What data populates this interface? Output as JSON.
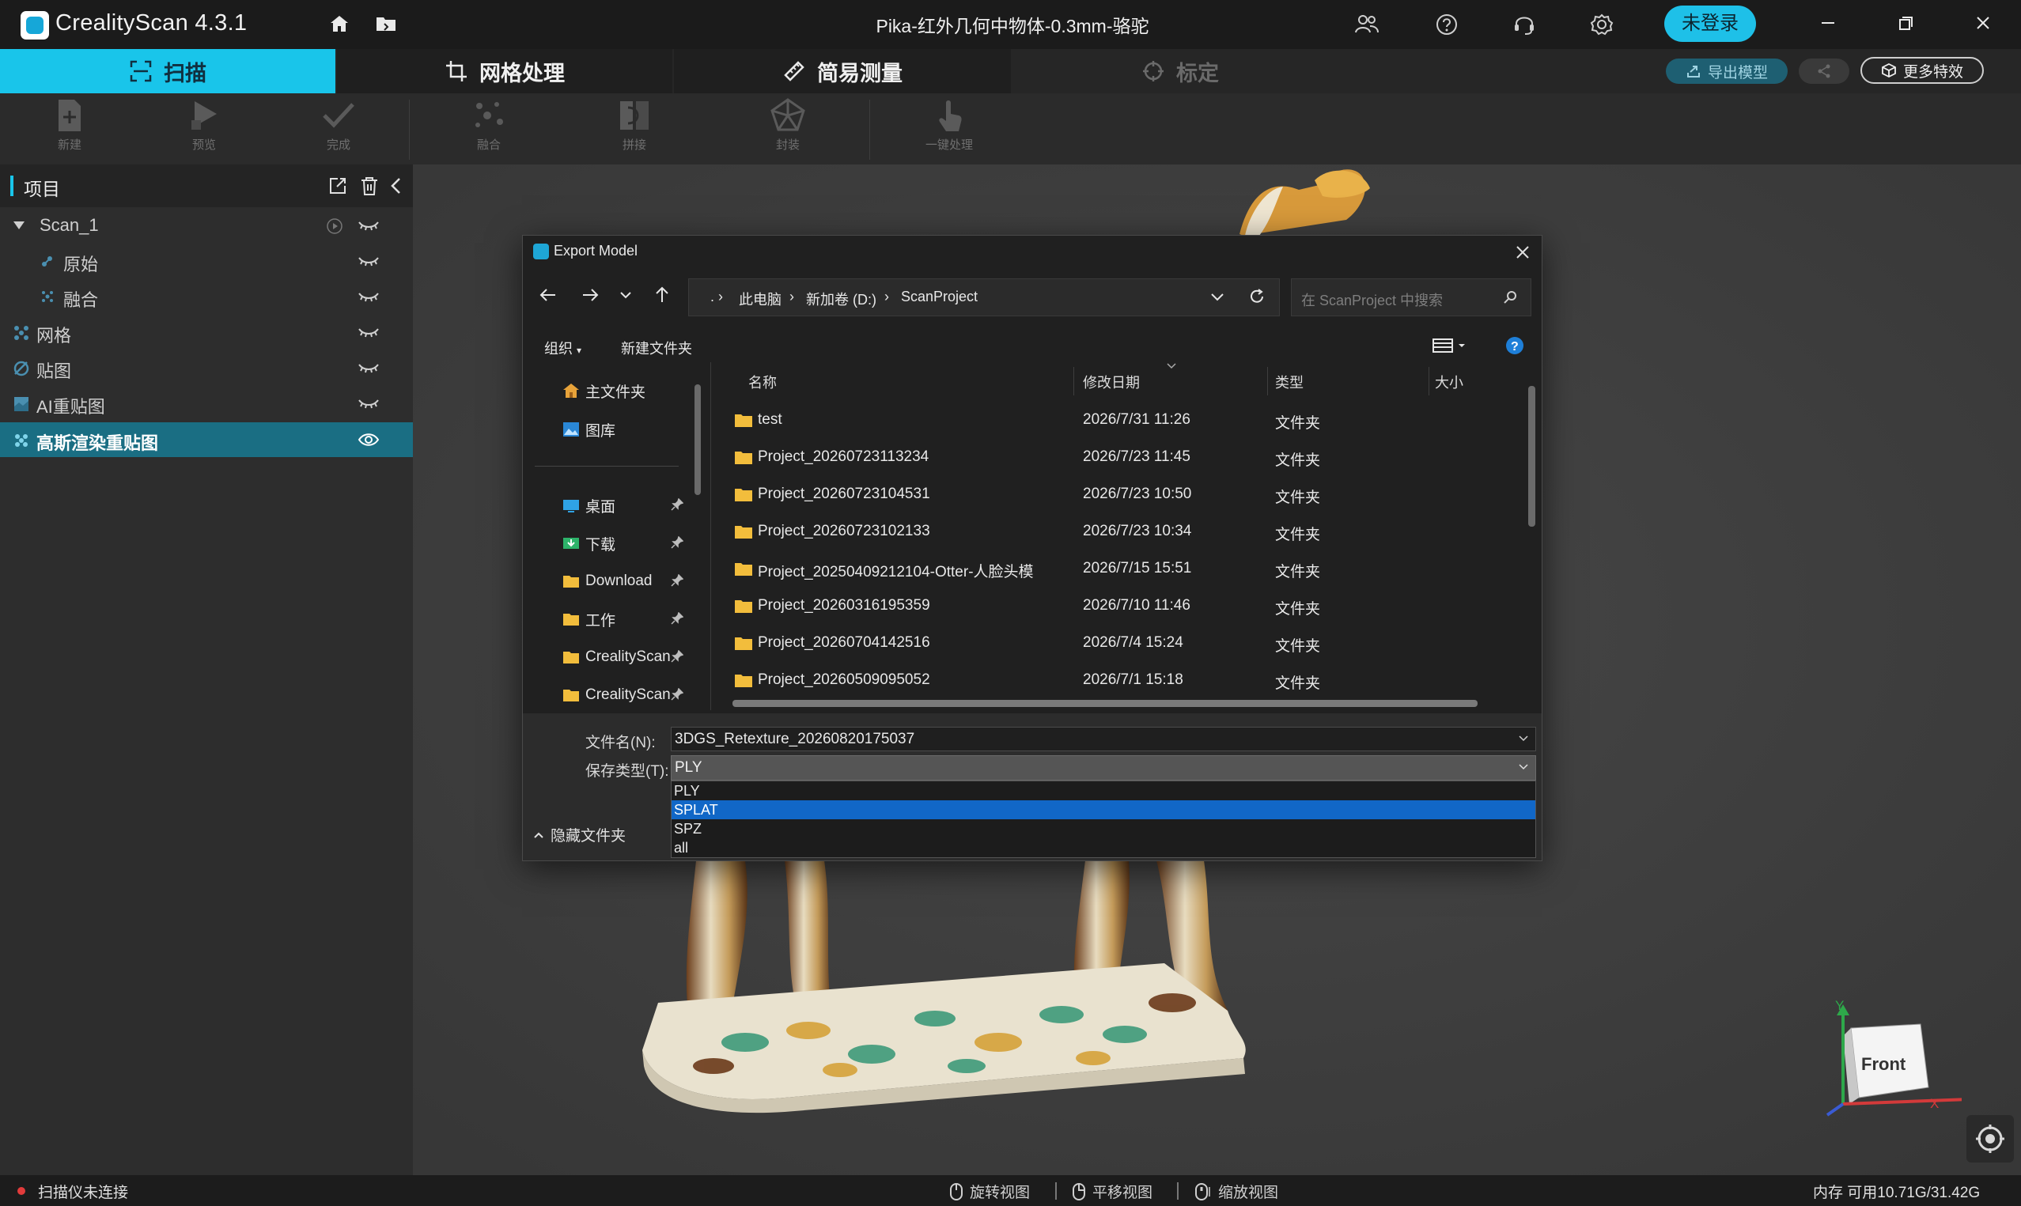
{
  "app": {
    "title": "CrealityScan 4.3.1",
    "document_title": "Pika-红外几何中物体-0.3mm-骆驼",
    "login_label": "未登录"
  },
  "modules": {
    "scan": "扫描",
    "mesh": "网格处理",
    "measure": "简易测量",
    "calibrate": "标定"
  },
  "top_actions": {
    "export": "导出模型",
    "more_effects": "更多特效"
  },
  "toolbar": {
    "new": "新建",
    "preview": "预览",
    "done": "完成",
    "fuse": "融合",
    "stitch": "拼接",
    "encapsulate": "封装",
    "one_click": "一键处理"
  },
  "project_panel": {
    "title": "项目",
    "items": [
      {
        "label": "Scan_1"
      },
      {
        "label": "原始"
      },
      {
        "label": "融合"
      },
      {
        "label": "网格"
      },
      {
        "label": "贴图"
      },
      {
        "label": "AI重贴图"
      },
      {
        "label": "高斯渲染重贴图"
      }
    ]
  },
  "dialog": {
    "title": "Export Model",
    "breadcrumbs": [
      "此电脑",
      "新加卷 (D:)",
      "ScanProject"
    ],
    "search_placeholder": "在 ScanProject 中搜索",
    "organize": "组织",
    "new_folder": "新建文件夹",
    "nav": [
      {
        "label": "主文件夹"
      },
      {
        "label": "图库"
      },
      {
        "label": "桌面"
      },
      {
        "label": "下载"
      },
      {
        "label": "Download"
      },
      {
        "label": "工作"
      },
      {
        "label": "CrealityScan"
      },
      {
        "label": "CrealityScan"
      }
    ],
    "columns": {
      "name": "名称",
      "modified": "修改日期",
      "type": "类型",
      "size": "大小"
    },
    "files": [
      {
        "name": "test",
        "date": "2026/7/31 11:26",
        "type": "文件夹"
      },
      {
        "name": "Project_20260723113234",
        "date": "2026/7/23 11:45",
        "type": "文件夹"
      },
      {
        "name": "Project_20260723104531",
        "date": "2026/7/23 10:50",
        "type": "文件夹"
      },
      {
        "name": "Project_20260723102133",
        "date": "2026/7/23 10:34",
        "type": "文件夹"
      },
      {
        "name": "Project_20250409212104-Otter-人脸头模",
        "date": "2026/7/15 15:51",
        "type": "文件夹"
      },
      {
        "name": "Project_20260316195359",
        "date": "2026/7/10 11:46",
        "type": "文件夹"
      },
      {
        "name": "Project_20260704142516",
        "date": "2026/7/4 15:24",
        "type": "文件夹"
      },
      {
        "name": "Project_20260509095052",
        "date": "2026/7/1 15:18",
        "type": "文件夹"
      }
    ],
    "filename_label": "文件名(N):",
    "filename_value": "3DGS_Retexture_20260820175037",
    "type_label": "保存类型(T):",
    "type_value": "PLY",
    "type_options": [
      "PLY",
      "SPLAT",
      "SPZ",
      "all"
    ],
    "hide_folders": "隐藏文件夹"
  },
  "status": {
    "scanner": "扫描仪未连接",
    "rotate": "旋转视图",
    "pan": "平移视图",
    "zoom": "缩放视图",
    "memory": "内存 可用10.71G/31.42G"
  },
  "navcube": {
    "face": "Front",
    "x": "X",
    "y": "Y"
  },
  "colors": {
    "accent": "#19c5ea",
    "selected_row": "#1a6e83",
    "dropdown_highlight": "#1167c7"
  }
}
